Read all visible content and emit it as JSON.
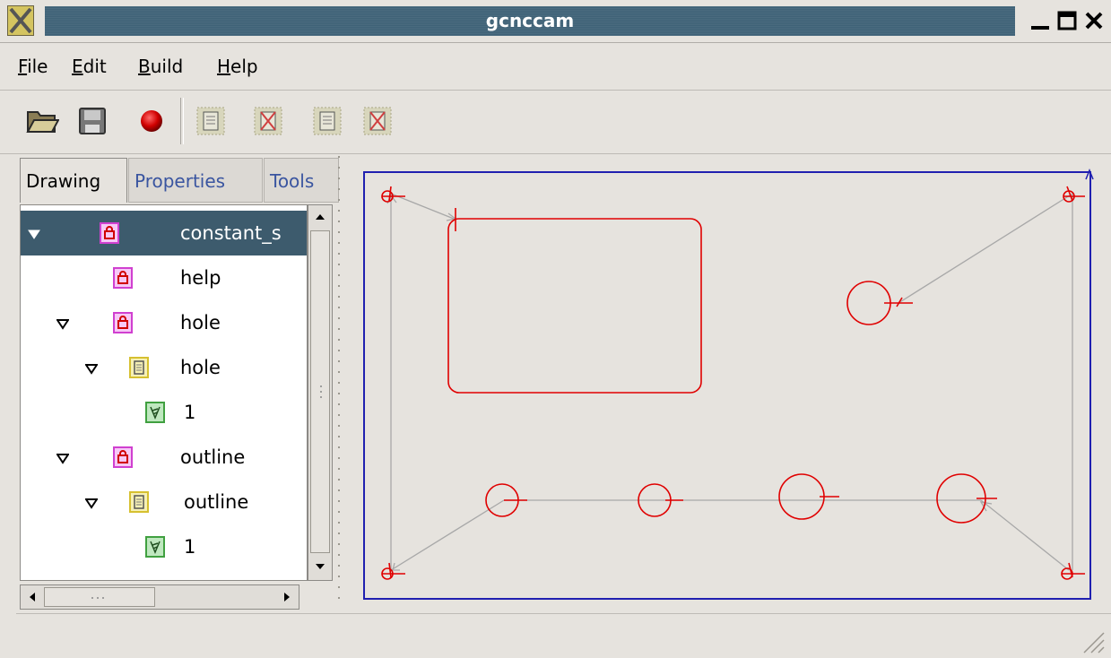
{
  "window": {
    "title": "gcnccam",
    "controls": {
      "minimize": "_",
      "maximize": "□",
      "close": "✕"
    }
  },
  "menu": {
    "items": [
      {
        "label": "File",
        "mnemonic": "F"
      },
      {
        "label": "Edit",
        "mnemonic": "E"
      },
      {
        "label": "Build",
        "mnemonic": "B"
      },
      {
        "label": "Help",
        "mnemonic": "H"
      }
    ]
  },
  "toolbar": {
    "buttons": [
      "open-icon",
      "save-icon",
      "record-icon",
      "layer-icon",
      "layer-remove-icon",
      "layer-icon",
      "layer-remove-icon"
    ]
  },
  "tabs": {
    "items": [
      {
        "label": "Drawing",
        "active": true
      },
      {
        "label": "Properties",
        "active": false
      },
      {
        "label": "Tools",
        "active": false
      }
    ]
  },
  "tree": {
    "rows": [
      {
        "label": "constant_s",
        "icon": "group-icon",
        "expanded": true,
        "selected": true,
        "level": 0
      },
      {
        "label": "help",
        "icon": "group-icon",
        "expanded": null,
        "selected": false,
        "level": 1
      },
      {
        "label": "hole",
        "icon": "group-icon",
        "expanded": true,
        "selected": false,
        "level": 1
      },
      {
        "label": "hole",
        "icon": "layer-icon",
        "expanded": true,
        "selected": false,
        "level": 2
      },
      {
        "label": "1",
        "icon": "tool-icon",
        "expanded": null,
        "selected": false,
        "level": 3
      },
      {
        "label": "outline",
        "icon": "group-icon",
        "expanded": true,
        "selected": false,
        "level": 1
      },
      {
        "label": "outline",
        "icon": "layer-icon",
        "expanded": true,
        "selected": false,
        "level": 2
      },
      {
        "label": "1",
        "icon": "tool-icon",
        "expanded": null,
        "selected": false,
        "level": 3
      }
    ]
  },
  "colors": {
    "titlebar": "#3f6277",
    "selection": "#3d5b6d",
    "toolpath": "#e00000",
    "boundary": "#2020b0",
    "rapid_move": "#a8a8a8",
    "background": "#e6e3de"
  },
  "statusbar": {
    "text": ""
  }
}
